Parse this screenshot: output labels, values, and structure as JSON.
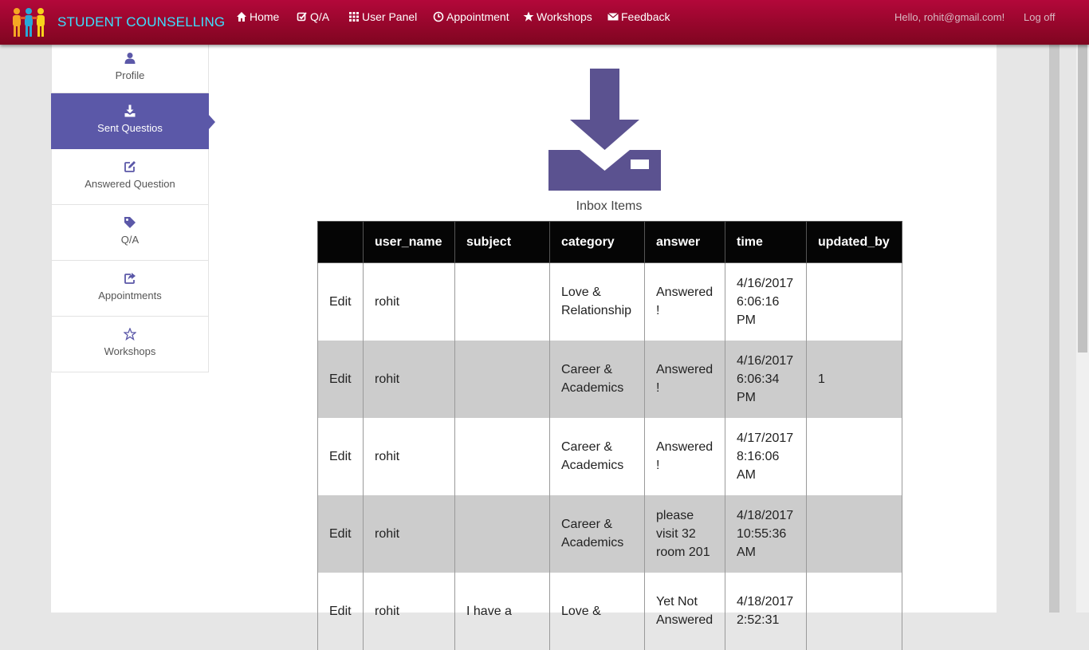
{
  "brand": {
    "title": "STUDENT COUNSELLING"
  },
  "nav": {
    "items": [
      {
        "label": "Home",
        "icon": "home-icon"
      },
      {
        "label": "Q/A",
        "icon": "edit-check-icon"
      },
      {
        "label": "User Panel",
        "icon": "grid-icon"
      },
      {
        "label": "Appointment",
        "icon": "clock-icon"
      },
      {
        "label": "Workshops",
        "icon": "star-icon"
      },
      {
        "label": "Feedback",
        "icon": "envelope-icon"
      }
    ],
    "greeting": "Hello, rohit@gmail.com!",
    "logout": "Log off"
  },
  "sidebar": {
    "items": [
      {
        "label": "Profile",
        "icon": "user-icon"
      },
      {
        "label": "Sent Questios",
        "icon": "download-icon",
        "active": true
      },
      {
        "label": "Answered Question",
        "icon": "edit-icon"
      },
      {
        "label": "Q/A",
        "icon": "tag-icon"
      },
      {
        "label": "Appointments",
        "icon": "share-icon"
      },
      {
        "label": "Workshops",
        "icon": "star-outline-icon"
      }
    ]
  },
  "inbox": {
    "label": "Inbox Items"
  },
  "table": {
    "columns": [
      "",
      "user_name",
      "subject",
      "category",
      "answer",
      "time",
      "updated_by"
    ],
    "rows": [
      {
        "action": "Edit",
        "user_name": "rohit",
        "subject": "",
        "category": "Love & Relationship",
        "answer": "Answered !",
        "time": "4/16/2017 6:06:16 PM",
        "updated_by": ""
      },
      {
        "action": "Edit",
        "user_name": "rohit",
        "subject": "",
        "category": "Career & Academics",
        "answer": "Answered !",
        "time": "4/16/2017 6:06:34 PM",
        "updated_by": "1"
      },
      {
        "action": "Edit",
        "user_name": "rohit",
        "subject": "",
        "category": "Career & Academics",
        "answer": "Answered !",
        "time": "4/17/2017 8:16:06 AM",
        "updated_by": ""
      },
      {
        "action": "Edit",
        "user_name": "rohit",
        "subject": "",
        "category": "Career & Academics",
        "answer": "please visit 32 room 201",
        "time": "4/18/2017 10:55:36 AM",
        "updated_by": ""
      },
      {
        "action": "Edit",
        "user_name": "rohit",
        "subject": "I have a",
        "category": "Love &",
        "answer": "Yet Not Answered",
        "time": "4/18/2017 2:52:31",
        "updated_by": ""
      }
    ]
  },
  "colors": {
    "navbar": "#9a0630",
    "brand_text": "#3ce0ff",
    "accent": "#5b58a8",
    "row_alt": "#cccccc",
    "header_bg": "#050505"
  }
}
